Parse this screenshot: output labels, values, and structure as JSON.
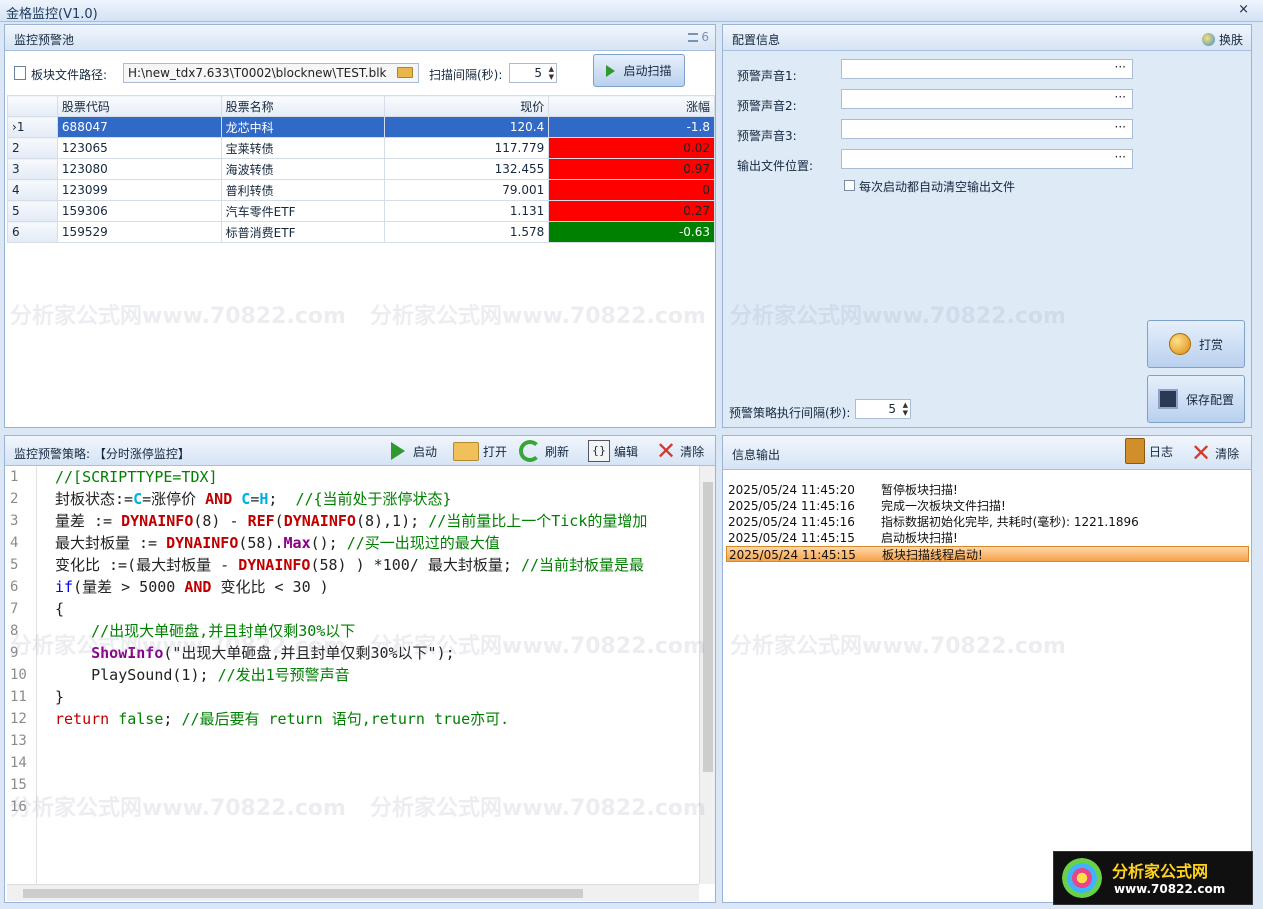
{
  "window": {
    "title": "金格监控(V1.0)",
    "close_glyph": "×"
  },
  "pool": {
    "title": "监控预警池",
    "list_icon_text": "6",
    "path_label": "板块文件路径:",
    "path_value": "H:\\new_tdx7.633\\T0002\\blocknew\\TEST.blk",
    "interval_label": "扫描间隔(秒):",
    "interval_value": "5",
    "start_scan_label": "启动扫描",
    "columns": [
      "股票代码",
      "股票名称",
      "现价",
      "涨幅"
    ],
    "rows": [
      {
        "idx": "1",
        "code": "688047",
        "name": "龙芯中科",
        "price": "120.4",
        "change": "-1.8"
      },
      {
        "idx": "2",
        "code": "123065",
        "name": "宝莱转债",
        "price": "117.779",
        "change": "0.02"
      },
      {
        "idx": "3",
        "code": "123080",
        "name": "海波转债",
        "price": "132.455",
        "change": "0.97"
      },
      {
        "idx": "4",
        "code": "123099",
        "name": "普利转债",
        "price": "79.001",
        "change": "0"
      },
      {
        "idx": "5",
        "code": "159306",
        "name": "汽车零件ETF",
        "price": "1.131",
        "change": "0.27"
      },
      {
        "idx": "6",
        "code": "159529",
        "name": "标普消费ETF",
        "price": "1.578",
        "change": "-0.63"
      }
    ],
    "selected_marker": "›"
  },
  "config": {
    "title": "配置信息",
    "skin_label": "换肤",
    "sound1_label": "预警声音1:",
    "sound2_label": "预警声音2:",
    "sound3_label": "预警声音3:",
    "output_label": "输出文件位置:",
    "browse_glyph": "···",
    "auto_clear_label": "每次启动都自动清空输出文件",
    "reward_label": "打赏",
    "save_label": "保存配置",
    "strategy_interval_label": "预警策略执行间隔(秒):",
    "strategy_interval_value": "5"
  },
  "strategy": {
    "title": "监控预警策略: 【分时涨停监控】",
    "start_label": "启动",
    "open_label": "打开",
    "refresh_label": "刷新",
    "edit_label": "编辑",
    "clear_label": "清除",
    "line_numbers": [
      "1",
      "2",
      "3",
      "4",
      "5",
      "6",
      "7",
      "8",
      "9",
      "10",
      "11",
      "12",
      "13",
      "14",
      "15",
      "16"
    ],
    "code": {
      "l1": "//[SCRIPTTYPE=TDX]",
      "l2a": "封板状态:=",
      "l2b": "C",
      "l2c": "=涨停价 ",
      "l2d": "AND",
      "l2e": " ",
      "l2f": "C",
      "l2g": "=",
      "l2h": "H",
      "l2i": ";  ",
      "l2j": "//{当前处于涨停状态}",
      "l3a": "量差 := ",
      "l3b": "DYNAINFO",
      "l3c": "(8) - ",
      "l3d": "REF",
      "l3e": "(",
      "l3f": "DYNAINFO",
      "l3g": "(8),1); ",
      "l3h": "//当前量比上一个Tick的量增加",
      "l4a": "最大封板量 := ",
      "l4b": "DYNAINFO",
      "l4c": "(58).",
      "l4d": "Max",
      "l4e": "(); ",
      "l4f": "//买一出现过的最大值",
      "l5a": "变化比 :=(最大封板量 - ",
      "l5b": "DYNAINFO",
      "l5c": "(58) ) *100/ 最大封板量; ",
      "l5d": "//当前封板量是最",
      "l6a": "if",
      "l6b": "(量差 > 5000 ",
      "l6c": "AND",
      "l6d": " 变化比 < 30 )",
      "l7": "{",
      "l8": "    //出现大单砸盘,并且封单仅剩30%以下",
      "l9a": "    ",
      "l9b": "ShowInfo",
      "l9c": "(\"出现大单砸盘,并且封单仅剩30%以下\");",
      "l10a": "    ",
      "l10b": "PlaySound",
      "l10c": "(1); ",
      "l10d": "//发出1号预警声音",
      "l11": "}",
      "l12a": "return",
      "l12b": " ",
      "l12c": "false",
      "l12d": "; ",
      "l12e": "//最后要有 return 语句,return true亦可."
    }
  },
  "info": {
    "title": "信息输出",
    "log_label": "日志",
    "clear_label": "清除",
    "entries": [
      {
        "time": "2025/05/24 11:45:20",
        "msg": "暂停板块扫描!"
      },
      {
        "time": "2025/05/24 11:45:16",
        "msg": "完成一次板块文件扫描!"
      },
      {
        "time": "2025/05/24 11:45:16",
        "msg": "指标数据初始化完毕, 共耗时(毫秒): 1221.1896"
      },
      {
        "time": "2025/05/24 11:45:15",
        "msg": "启动板块扫描!"
      },
      {
        "time": "2025/05/24 11:45:15",
        "msg": "板块扫描线程启动!"
      }
    ]
  },
  "watermark": {
    "text": "分析家公式网www.70822.com",
    "logo_cn": "分析家公式网",
    "logo_url": "www.70822.com"
  },
  "colors": {
    "up": "#ff0000",
    "down": "#008000",
    "selected_row": "#3169c6",
    "highlight": "#f6a24a"
  }
}
